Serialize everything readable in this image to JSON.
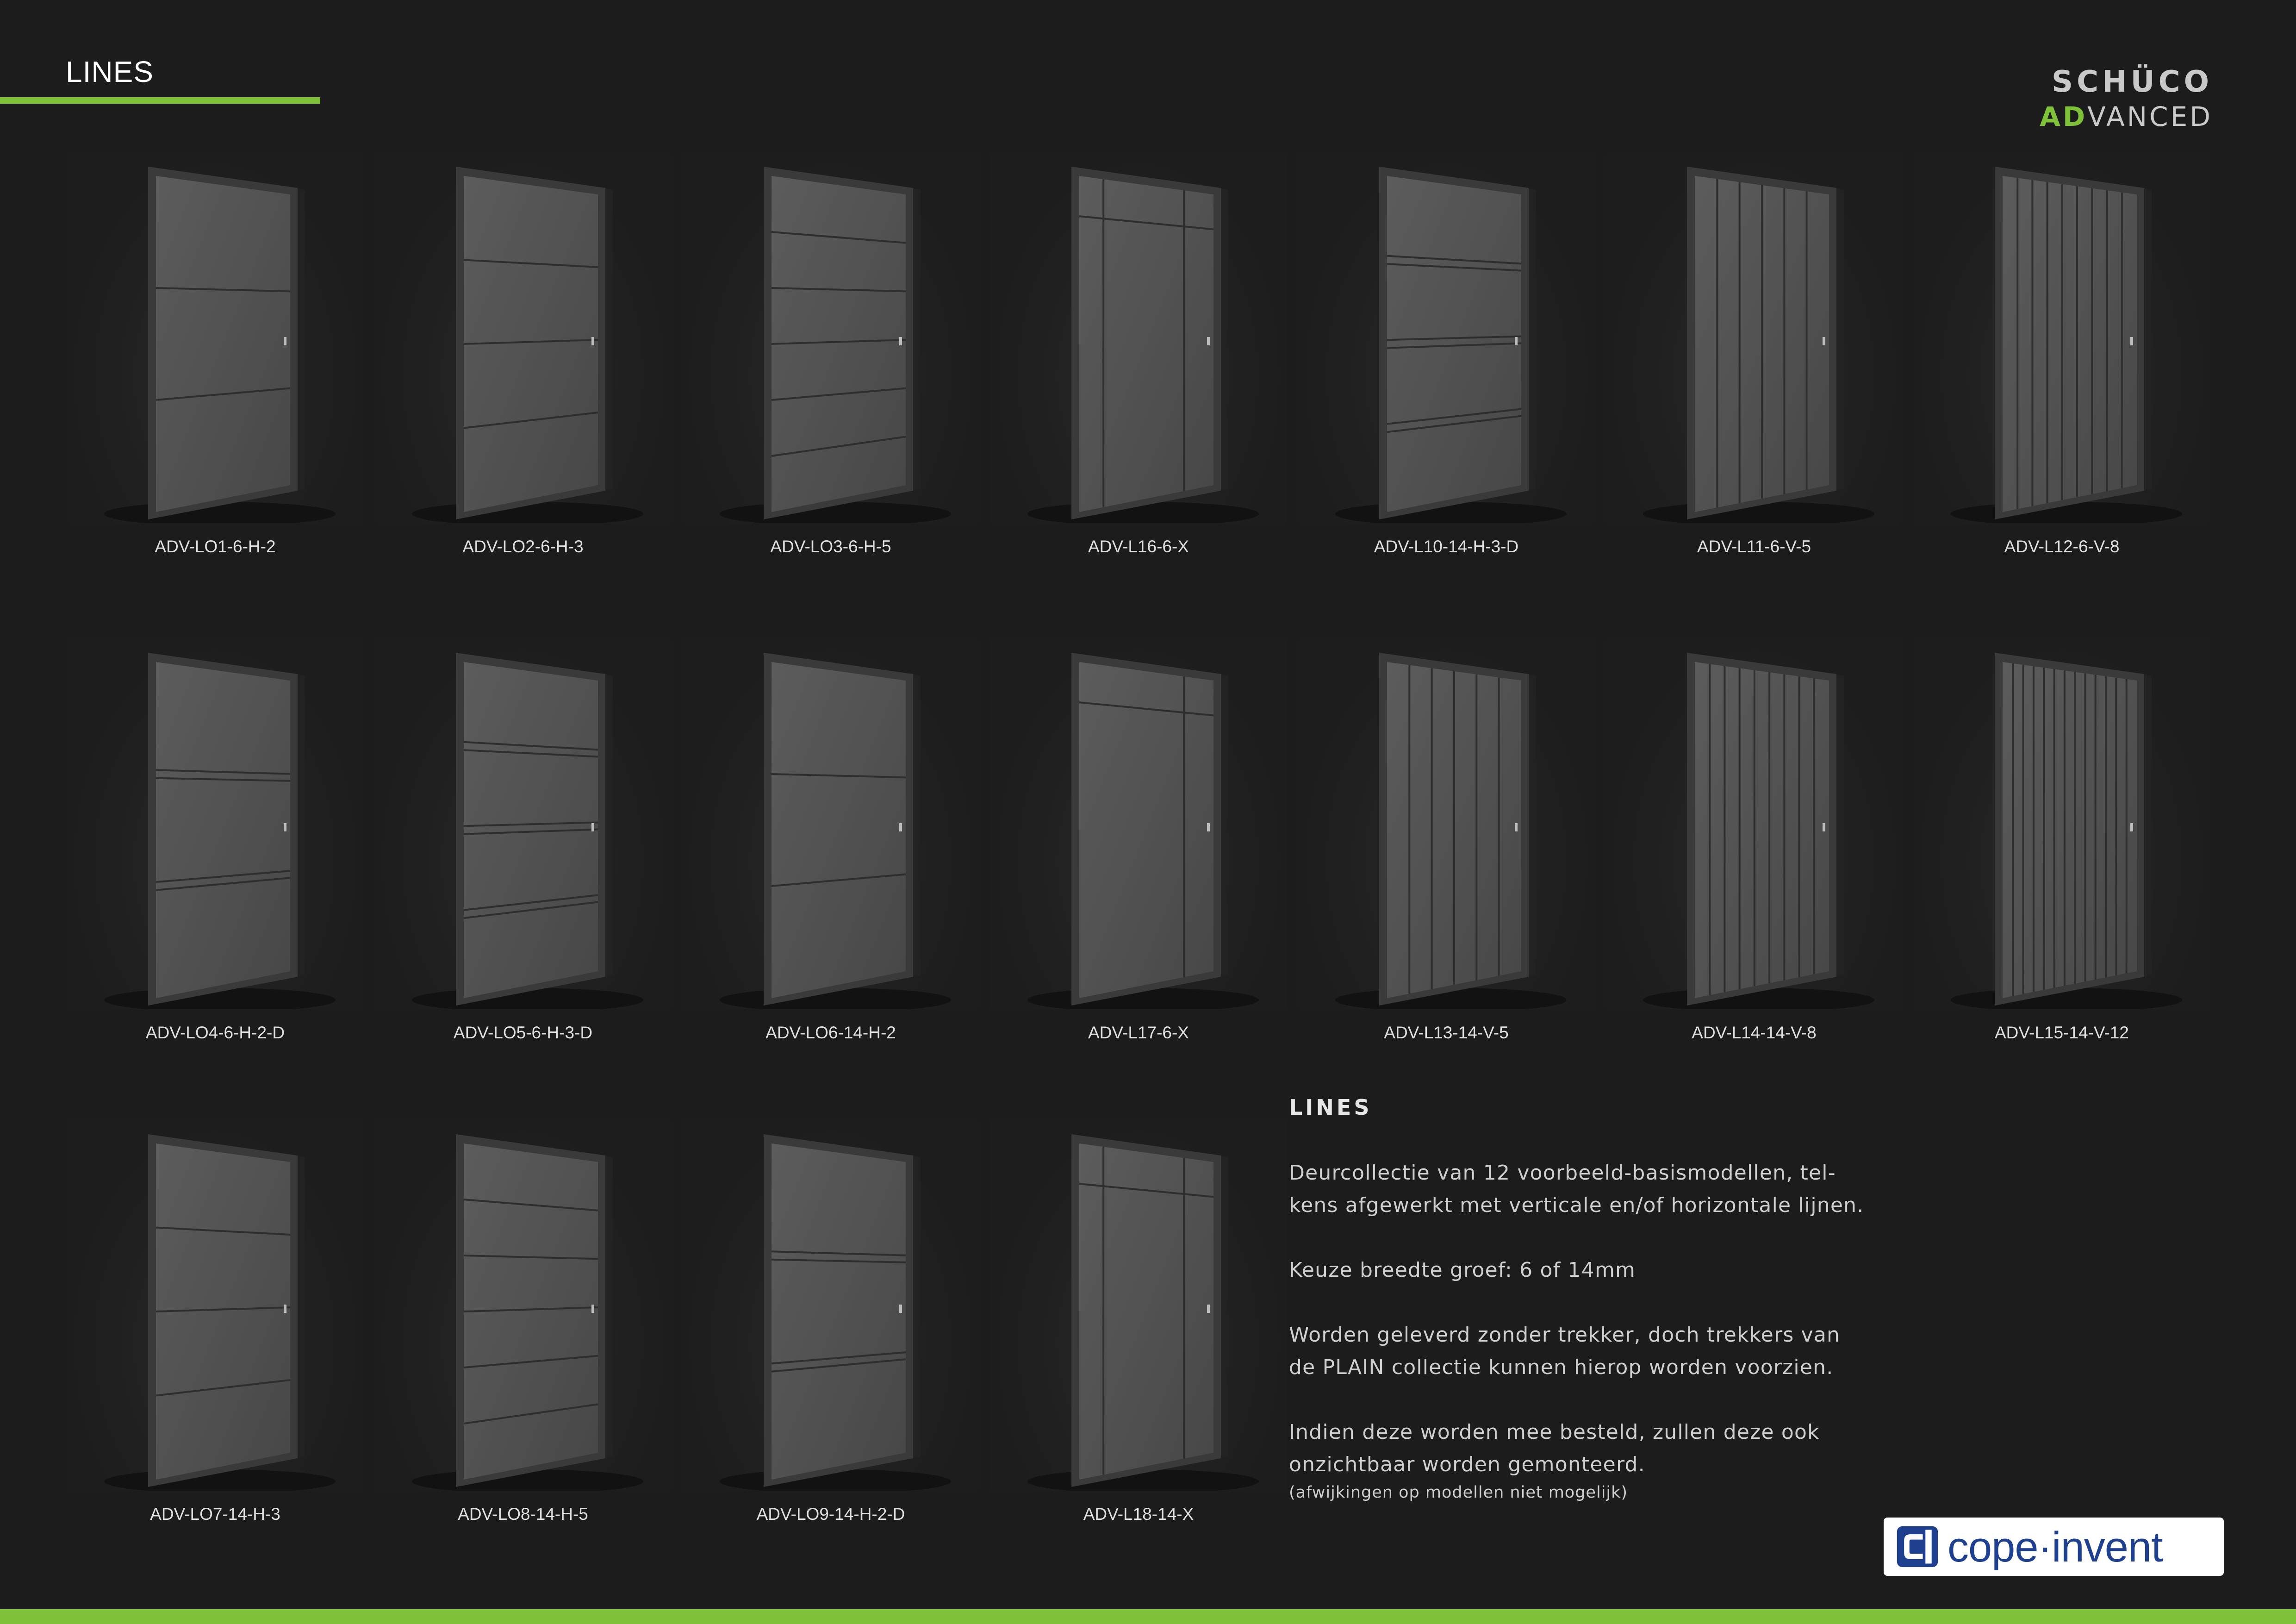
{
  "header": {
    "title": "LINES"
  },
  "brand": {
    "top": "SCHÜCO",
    "accent": "AD",
    "rest": "VANCED"
  },
  "accent_color": "#7fc23a",
  "doors": [
    {
      "label": "ADV-LO1-6-H-2",
      "lines": "h",
      "count": 2
    },
    {
      "label": "ADV-LO2-6-H-3",
      "lines": "h",
      "count": 3
    },
    {
      "label": "ADV-LO3-6-H-5",
      "lines": "h",
      "count": 5
    },
    {
      "label": "ADV-L16-6-X",
      "lines": "x",
      "count": 0
    },
    {
      "label": "ADV-L10-14-H-3-D",
      "lines": "hd",
      "count": 3
    },
    {
      "label": "ADV-L11-6-V-5",
      "lines": "v",
      "count": 5
    },
    {
      "label": "ADV-L12-6-V-8",
      "lines": "v",
      "count": 8
    },
    {
      "label": "ADV-LO4-6-H-2-D",
      "lines": "hd",
      "count": 2
    },
    {
      "label": "ADV-LO5-6-H-3-D",
      "lines": "hd",
      "count": 3
    },
    {
      "label": "ADV-LO6-14-H-2",
      "lines": "h",
      "count": 2
    },
    {
      "label": "ADV-L17-6-X",
      "lines": "x2",
      "count": 0
    },
    {
      "label": "ADV-L13-14-V-5",
      "lines": "v",
      "count": 5
    },
    {
      "label": "ADV-L14-14-V-8",
      "lines": "v",
      "count": 8
    },
    {
      "label": "ADV-L15-14-V-12",
      "lines": "v",
      "count": 12
    },
    {
      "label": "ADV-LO7-14-H-3",
      "lines": "h",
      "count": 3
    },
    {
      "label": "ADV-LO8-14-H-5",
      "lines": "h",
      "count": 5
    },
    {
      "label": "ADV-LO9-14-H-2-D",
      "lines": "hd",
      "count": 2
    },
    {
      "label": "ADV-L18-14-X",
      "lines": "x",
      "count": 0
    }
  ],
  "info": {
    "title": "LINES",
    "p1_line1": "Deurcollectie van 12 voorbeeld-basismodellen, tel-",
    "p1_line2": "kens afgewerkt met verticale en/of horizontale lijnen.",
    "p2": "Keuze breedte groef: 6 of 14mm",
    "p3_line1": "Worden geleverd zonder trekker, doch trekkers van",
    "p3_line2": "de PLAIN collectie kunnen hierop worden voorzien.",
    "p4_line1": "Indien deze worden mee besteld, zullen deze ook",
    "p4_line2": "onzichtbaar worden gemonteerd.",
    "note": "(afwijkingen op modellen niet mogelijk)"
  },
  "logo": {
    "text": "cope·invent",
    "icon": "cope-invent-mark-icon"
  }
}
